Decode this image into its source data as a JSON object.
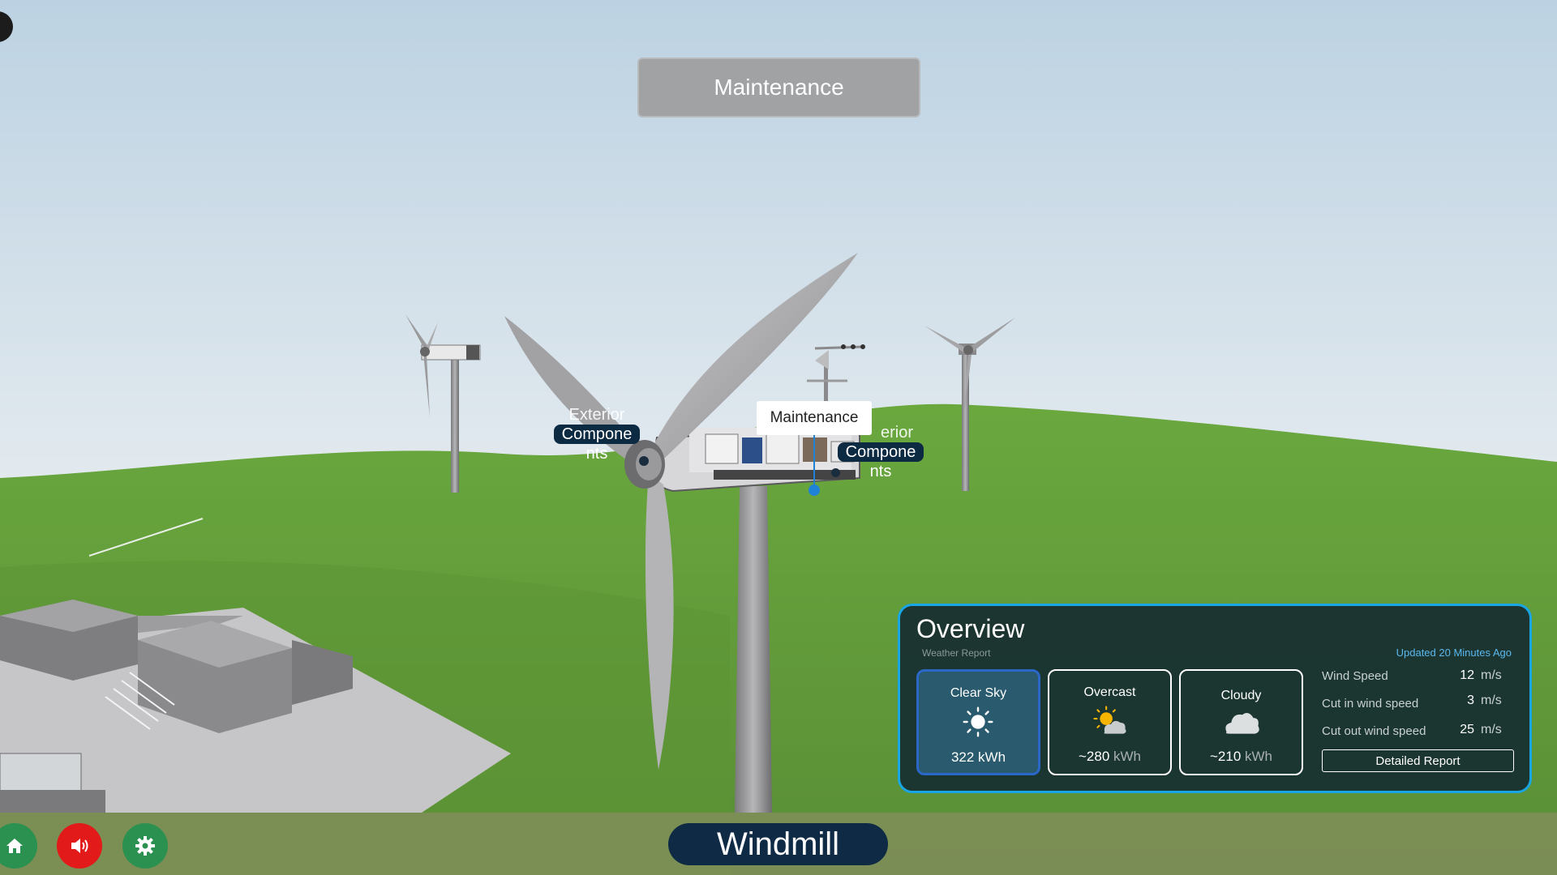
{
  "scene": {
    "mode_banner": "Maintenance",
    "hotspots": [
      {
        "line1": "Exterior",
        "line2": "Compone",
        "line3": "nts"
      },
      {
        "line1": "erior",
        "line2": "Compone",
        "line3": "nts"
      }
    ],
    "maintenance_tag": "Maintenance"
  },
  "overview": {
    "title": "Overview",
    "subtitle": "Weather Report",
    "updated": "Updated 20 Minutes Ago",
    "weather_cards": [
      {
        "label": "Clear Sky",
        "icon": "sun-icon",
        "value": "322 kWh",
        "unit": "",
        "active": true
      },
      {
        "label": "Overcast",
        "icon": "partly-cloudy-icon",
        "value": "~280",
        "unit": "kWh",
        "active": false
      },
      {
        "label": "Cloudy",
        "icon": "cloud-icon",
        "value": "~210",
        "unit": "kWh",
        "active": false
      }
    ],
    "stats": [
      {
        "label": "Wind Speed",
        "value": "12",
        "unit": "m/s"
      },
      {
        "label": "Cut in wind speed",
        "value": "3",
        "unit": "m/s"
      },
      {
        "label": "Cut out wind speed",
        "value": "25",
        "unit": "m/s"
      }
    ],
    "report_button": "Detailed Report"
  },
  "bottom": {
    "title": "Windmill",
    "buttons": [
      "home-icon",
      "speaker-icon",
      "gear-icon"
    ]
  },
  "colors": {
    "accent_blue": "#19a6e5",
    "panel_bg": "#162c30",
    "title_pill": "#0e2a45",
    "green_button": "#2a9150",
    "red_button": "#e21a1a",
    "grass": "#5f9a3a"
  }
}
